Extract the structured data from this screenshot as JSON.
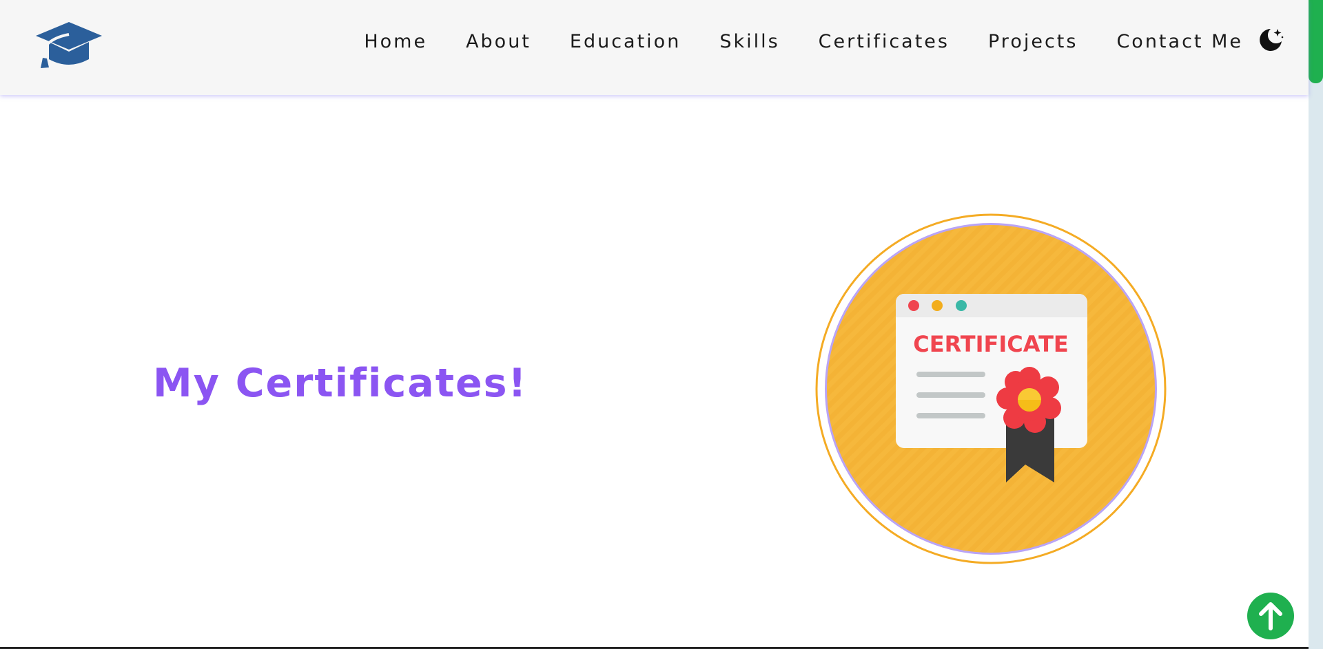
{
  "nav": {
    "items": [
      "Home",
      "About",
      "Education",
      "Skills",
      "Certificates",
      "Projects",
      "Contact Me"
    ]
  },
  "hero": {
    "title": "My Certificates!",
    "image_text": "CERTIFICATE"
  },
  "icons": {
    "logo": "graduation-cap-icon",
    "theme_toggle": "moon-icon",
    "scroll_top": "arrow-up-icon"
  },
  "colors": {
    "accent": "#8b55f2",
    "logo": "#2b5f9b",
    "scroll_button": "#1fb04f",
    "circle": "#f6b83c"
  }
}
